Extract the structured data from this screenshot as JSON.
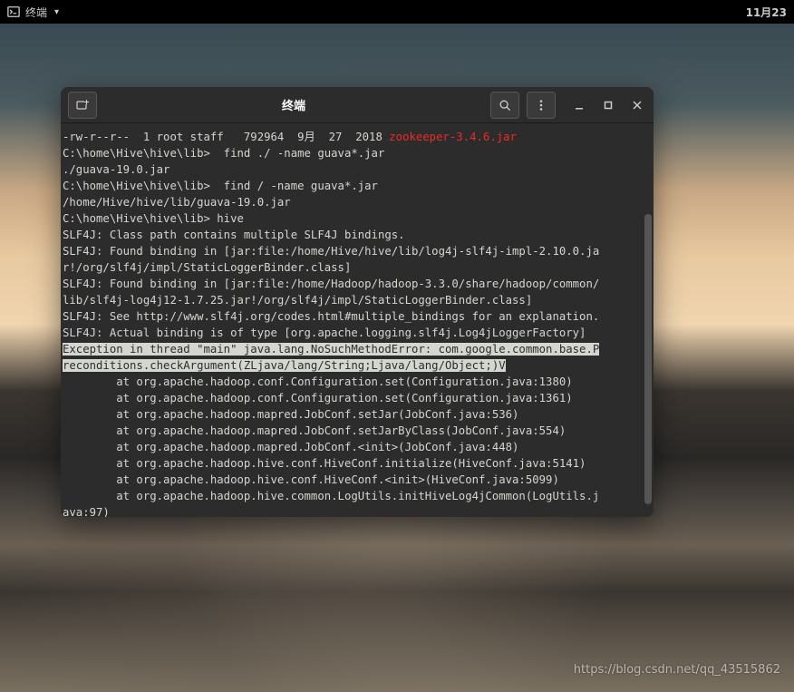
{
  "topbar": {
    "app_name": "终端",
    "dropdown_icon": "▾",
    "date": "11月23"
  },
  "window": {
    "title": "终端"
  },
  "terminal": {
    "lines": [
      {
        "text": "-rw-r--r--  1 root staff   792964  9月  27  2018 ",
        "suffix": "zookeeper-3.4.6.jar",
        "suffix_class": "red-text"
      },
      {
        "text": "C:\\home\\Hive\\hive\\lib>  find ./ -name guava*.jar"
      },
      {
        "text": "./guava-19.0.jar"
      },
      {
        "text": "C:\\home\\Hive\\hive\\lib>  find / -name guava*.jar"
      },
      {
        "text": "/home/Hive/hive/lib/guava-19.0.jar"
      },
      {
        "text": "C:\\home\\Hive\\hive\\lib> hive"
      },
      {
        "text": "SLF4J: Class path contains multiple SLF4J bindings."
      },
      {
        "text": "SLF4J: Found binding in [jar:file:/home/Hive/hive/lib/log4j-slf4j-impl-2.10.0.ja"
      },
      {
        "text": "r!/org/slf4j/impl/StaticLoggerBinder.class]"
      },
      {
        "text": "SLF4J: Found binding in [jar:file:/home/Hadoop/hadoop-3.3.0/share/hadoop/common/"
      },
      {
        "text": "lib/slf4j-log4j12-1.7.25.jar!/org/slf4j/impl/StaticLoggerBinder.class]"
      },
      {
        "text": "SLF4J: See http://www.slf4j.org/codes.html#multiple_bindings for an explanation."
      },
      {
        "text": "SLF4J: Actual binding is of type [org.apache.logging.slf4j.Log4jLoggerFactory]"
      },
      {
        "text": "Exception in thread \"main\" java.lang.NoSuchMethodError: com.google.common.base.P",
        "highlight": true
      },
      {
        "text": "reconditions.checkArgument(ZLjava/lang/String;Ljava/lang/Object;)V",
        "highlight": true
      },
      {
        "text": "        at org.apache.hadoop.conf.Configuration.set(Configuration.java:1380)"
      },
      {
        "text": "        at org.apache.hadoop.conf.Configuration.set(Configuration.java:1361)"
      },
      {
        "text": "        at org.apache.hadoop.mapred.JobConf.setJar(JobConf.java:536)"
      },
      {
        "text": "        at org.apache.hadoop.mapred.JobConf.setJarByClass(JobConf.java:554)"
      },
      {
        "text": "        at org.apache.hadoop.mapred.JobConf.<init>(JobConf.java:448)"
      },
      {
        "text": "        at org.apache.hadoop.hive.conf.HiveConf.initialize(HiveConf.java:5141)"
      },
      {
        "text": "        at org.apache.hadoop.hive.conf.HiveConf.<init>(HiveConf.java:5099)"
      },
      {
        "text": "        at org.apache.hadoop.hive.common.LogUtils.initHiveLog4jCommon(LogUtils.j"
      },
      {
        "text": "ava:97)"
      }
    ]
  },
  "watermark": "https://blog.csdn.net/qq_43515862"
}
